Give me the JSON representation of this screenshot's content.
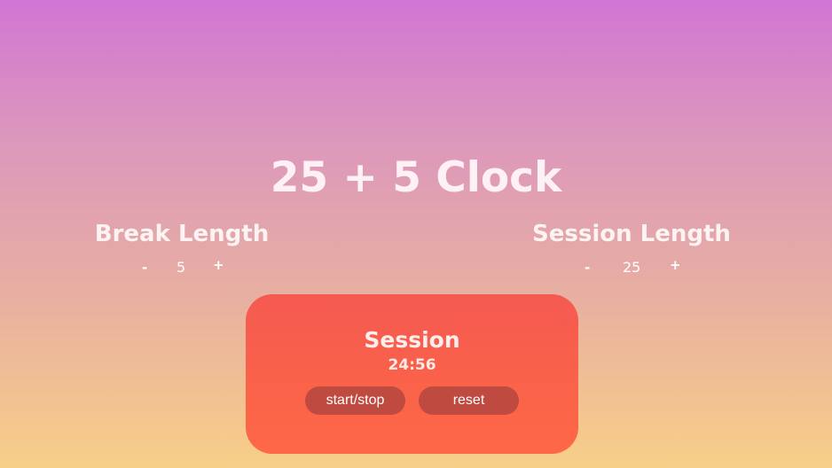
{
  "app": {
    "title": "25 + 5 Clock"
  },
  "break": {
    "label": "Break Length",
    "decrement": "-",
    "value": "5",
    "increment": "+"
  },
  "session": {
    "label": "Session Length",
    "decrement": "-",
    "value": "25",
    "increment": "+"
  },
  "timer": {
    "label": "Session",
    "time": "24:56",
    "start_stop_label": "start/stop",
    "reset_label": "reset"
  },
  "colors": {
    "background_top": "#d175d4",
    "background_bottom": "#f8cf88",
    "card_top": "#f55a50",
    "card_bottom": "#fe6846",
    "button": "#bf4a3f"
  }
}
